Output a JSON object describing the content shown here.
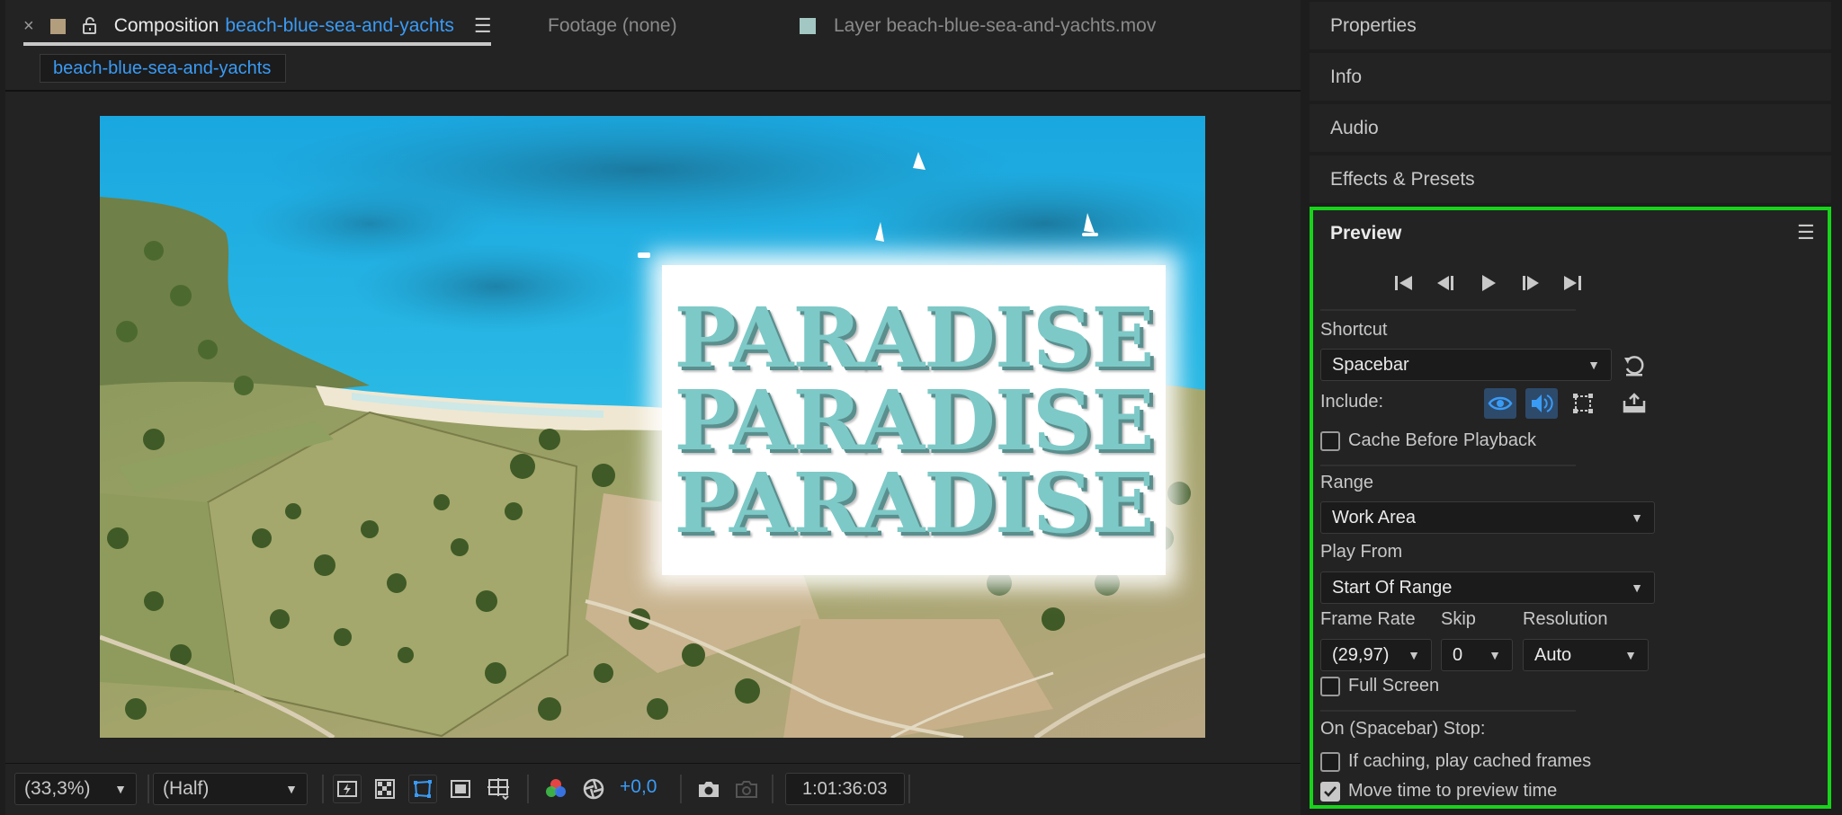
{
  "composition_panel": {
    "tabs": {
      "composition": {
        "close": "×",
        "prefix": "Composition",
        "name": "beach-blue-sea-and-yachts",
        "menu": "☰"
      },
      "footage": {
        "label": "Footage (none)"
      },
      "layer": {
        "label": "Layer beach-blue-sea-and-yachts.mov"
      }
    },
    "breadcrumb": "beach-blue-sea-and-yachts",
    "title_card_lines": [
      "PARADISE",
      "PARADISE",
      "PARADISE"
    ],
    "toolbar": {
      "zoom": "(33,3%)",
      "resolution": "(Half)",
      "exposure": "+0,0",
      "timecode": "1:01:36:03"
    }
  },
  "right_column": {
    "panels": [
      "Properties",
      "Info",
      "Audio",
      "Effects & Presets"
    ],
    "preview": {
      "title": "Preview",
      "menu": "☰",
      "shortcut_label": "Shortcut",
      "shortcut_value": "Spacebar",
      "include_label": "Include:",
      "cache_before_playback": {
        "label": "Cache Before Playback",
        "checked": false
      },
      "range_label": "Range",
      "range_value": "Work Area",
      "play_from_label": "Play From",
      "play_from_value": "Start Of Range",
      "frame_rate_label": "Frame Rate",
      "frame_rate_value": "(29,97)",
      "skip_label": "Skip",
      "skip_value": "0",
      "resolution_label": "Resolution",
      "resolution_value": "Auto",
      "full_screen": {
        "label": "Full Screen",
        "checked": false
      },
      "on_stop_label": "On (Spacebar) Stop:",
      "if_caching": {
        "label": "If caching, play cached frames",
        "checked": false
      },
      "move_time": {
        "label": "Move time to preview time",
        "checked": true
      }
    }
  },
  "colors": {
    "accent_blue": "#3a9bf5",
    "highlight_green": "#17d41a",
    "title_teal": "#7dc9c7"
  }
}
